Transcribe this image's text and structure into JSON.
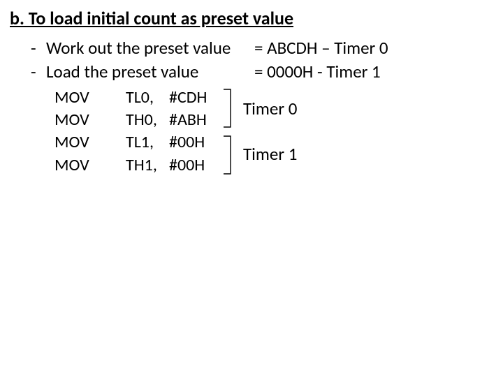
{
  "heading": "b. To load initial count as preset value",
  "bullets": [
    {
      "left": "Work out the preset value",
      "right": "=  ABCDH – Timer 0"
    },
    {
      "left": "Load the preset value",
      "right": "=  0000H -   Timer 1"
    }
  ],
  "instructions": [
    {
      "op": "MOV",
      "reg": "TL0,",
      "val": "#CDH"
    },
    {
      "op": "MOV",
      "reg": "TH0,",
      "val": "#ABH"
    },
    {
      "op": "MOV",
      "reg": "TL1,",
      "val": "#00H"
    },
    {
      "op": "MOV",
      "reg": "TH1,",
      "val": "#00H"
    }
  ],
  "timer_labels": [
    "Timer 0",
    "Timer 1"
  ]
}
